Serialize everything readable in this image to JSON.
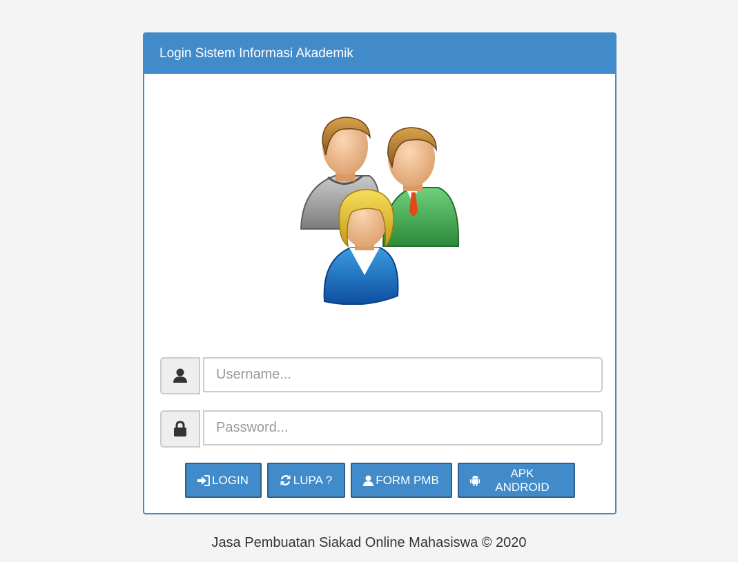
{
  "panel": {
    "title": "Login Sistem Informasi Akademik"
  },
  "login_form": {
    "username_placeholder": "Username...",
    "password_placeholder": "Password...",
    "username_icon": "user-icon",
    "password_icon": "lock-icon"
  },
  "buttons": {
    "login": {
      "label": "LOGIN",
      "icon": "sign-in-icon"
    },
    "lupa": {
      "label": "LUPA ?",
      "icon": "refresh-icon"
    },
    "form_pmb": {
      "label": "FORM PMB",
      "icon": "user-icon"
    },
    "apk_android": {
      "label": "APK ANDROID",
      "icon": "android-icon"
    }
  },
  "footer": {
    "text": "Jasa Pembuatan Siakad Online Mahasiswa © 2020"
  },
  "colors": {
    "primary": "#428bca",
    "background": "#f4f4f4"
  }
}
